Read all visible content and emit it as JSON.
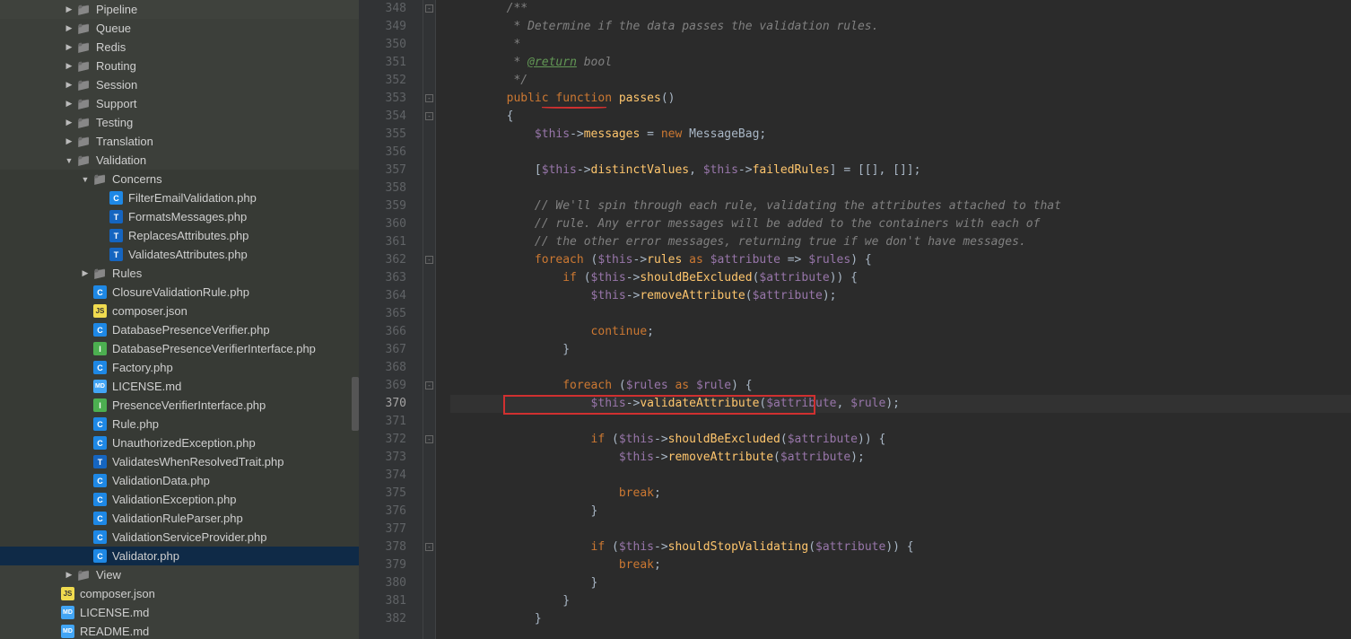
{
  "sidebar": {
    "items": [
      {
        "depth": 4,
        "arrow": "right",
        "icon": "folder",
        "label": "Pipeline",
        "shade": false
      },
      {
        "depth": 4,
        "arrow": "right",
        "icon": "folder",
        "label": "Queue",
        "shade": false
      },
      {
        "depth": 4,
        "arrow": "right",
        "icon": "folder",
        "label": "Redis",
        "shade": false
      },
      {
        "depth": 4,
        "arrow": "right",
        "icon": "folder",
        "label": "Routing",
        "shade": false
      },
      {
        "depth": 4,
        "arrow": "right",
        "icon": "folder",
        "label": "Session",
        "shade": false
      },
      {
        "depth": 4,
        "arrow": "right",
        "icon": "folder",
        "label": "Support",
        "shade": false
      },
      {
        "depth": 4,
        "arrow": "right",
        "icon": "folder",
        "label": "Testing",
        "shade": false
      },
      {
        "depth": 4,
        "arrow": "right",
        "icon": "folder",
        "label": "Translation",
        "shade": false
      },
      {
        "depth": 4,
        "arrow": "down",
        "icon": "folder",
        "label": "Validation",
        "shade": false
      },
      {
        "depth": 5,
        "arrow": "down",
        "icon": "folder",
        "label": "Concerns",
        "shade": true
      },
      {
        "depth": 6,
        "arrow": "",
        "icon": "c-blue",
        "iconText": "C",
        "label": "FilterEmailValidation.php",
        "shade": true
      },
      {
        "depth": 6,
        "arrow": "",
        "icon": "t-blue",
        "iconText": "T",
        "label": "FormatsMessages.php",
        "shade": true
      },
      {
        "depth": 6,
        "arrow": "",
        "icon": "t-blue",
        "iconText": "T",
        "label": "ReplacesAttributes.php",
        "shade": true
      },
      {
        "depth": 6,
        "arrow": "",
        "icon": "t-blue",
        "iconText": "T",
        "label": "ValidatesAttributes.php",
        "shade": true
      },
      {
        "depth": 5,
        "arrow": "right",
        "icon": "folder",
        "label": "Rules",
        "shade": true
      },
      {
        "depth": 5,
        "arrow": "",
        "icon": "c-blue",
        "iconText": "C",
        "label": "ClosureValidationRule.php",
        "shade": true
      },
      {
        "depth": 5,
        "arrow": "",
        "icon": "js-yellow",
        "iconText": "JS",
        "label": "composer.json",
        "shade": true
      },
      {
        "depth": 5,
        "arrow": "",
        "icon": "c-blue",
        "iconText": "C",
        "label": "DatabasePresenceVerifier.php",
        "shade": true
      },
      {
        "depth": 5,
        "arrow": "",
        "icon": "i-green",
        "iconText": "I",
        "label": "DatabasePresenceVerifierInterface.php",
        "shade": true
      },
      {
        "depth": 5,
        "arrow": "",
        "icon": "c-blue",
        "iconText": "C",
        "label": "Factory.php",
        "shade": true
      },
      {
        "depth": 5,
        "arrow": "",
        "icon": "md",
        "iconText": "MD",
        "label": "LICENSE.md",
        "shade": true
      },
      {
        "depth": 5,
        "arrow": "",
        "icon": "i-green",
        "iconText": "I",
        "label": "PresenceVerifierInterface.php",
        "shade": true
      },
      {
        "depth": 5,
        "arrow": "",
        "icon": "c-blue",
        "iconText": "C",
        "label": "Rule.php",
        "shade": true
      },
      {
        "depth": 5,
        "arrow": "",
        "icon": "c-blue",
        "iconText": "C",
        "label": "UnauthorizedException.php",
        "shade": true
      },
      {
        "depth": 5,
        "arrow": "",
        "icon": "t-blue",
        "iconText": "T",
        "label": "ValidatesWhenResolvedTrait.php",
        "shade": true
      },
      {
        "depth": 5,
        "arrow": "",
        "icon": "c-blue",
        "iconText": "C",
        "label": "ValidationData.php",
        "shade": true
      },
      {
        "depth": 5,
        "arrow": "",
        "icon": "c-blue",
        "iconText": "C",
        "label": "ValidationException.php",
        "shade": true
      },
      {
        "depth": 5,
        "arrow": "",
        "icon": "c-blue",
        "iconText": "C",
        "label": "ValidationRuleParser.php",
        "shade": true
      },
      {
        "depth": 5,
        "arrow": "",
        "icon": "c-blue",
        "iconText": "C",
        "label": "ValidationServiceProvider.php",
        "shade": true
      },
      {
        "depth": 5,
        "arrow": "",
        "icon": "c-blue",
        "iconText": "C",
        "label": "Validator.php",
        "shade": true,
        "selected": true
      },
      {
        "depth": 4,
        "arrow": "right",
        "icon": "folder",
        "label": "View",
        "shade": false
      },
      {
        "depth": 3,
        "arrow": "",
        "icon": "js-yellow",
        "iconText": "JS",
        "label": "composer.json",
        "shade": false
      },
      {
        "depth": 3,
        "arrow": "",
        "icon": "md",
        "iconText": "MD",
        "label": "LICENSE.md",
        "shade": false
      },
      {
        "depth": 3,
        "arrow": "",
        "icon": "md",
        "iconText": "MD",
        "label": "README.md",
        "shade": false
      }
    ]
  },
  "editor": {
    "first_line": 348,
    "current_line": 370,
    "lines": [
      {
        "n": 348,
        "raw": "     /**",
        "tokens": [
          [
            "k-comment",
            "/**"
          ]
        ],
        "indent": 2
      },
      {
        "n": 349,
        "raw": "      * Determine if the data passes the validation rules.",
        "tokens": [
          [
            "k-comment",
            " * Determine if the data passes the validation rules."
          ]
        ],
        "indent": 2
      },
      {
        "n": 350,
        "raw": "      *",
        "tokens": [
          [
            "k-comment",
            " *"
          ]
        ],
        "indent": 2
      },
      {
        "n": 351,
        "raw": "      * @return bool",
        "tokens": [
          [
            "k-comment",
            " * "
          ],
          [
            "k-doctag",
            "@return"
          ],
          [
            "k-comment",
            " bool"
          ]
        ],
        "indent": 2
      },
      {
        "n": 352,
        "raw": "      */",
        "tokens": [
          [
            "k-comment",
            " */"
          ]
        ],
        "indent": 2
      },
      {
        "n": 353,
        "raw": "     public function passes()",
        "tokens": [
          [
            "k-orange",
            "public function "
          ],
          [
            "k-func",
            "passes"
          ],
          [
            "k-op",
            "()"
          ]
        ],
        "indent": 2
      },
      {
        "n": 354,
        "raw": "     {",
        "tokens": [
          [
            "k-op",
            "{"
          ]
        ],
        "indent": 2
      },
      {
        "n": 355,
        "raw": "         $this->messages = new MessageBag;",
        "tokens": [
          [
            "k-var",
            "$this"
          ],
          [
            "k-op",
            "->"
          ],
          [
            "k-func",
            "messages"
          ],
          [
            "k-op",
            " = "
          ],
          [
            "k-orange",
            "new "
          ],
          [
            "k-type",
            "MessageBag"
          ],
          [
            "k-op",
            ";"
          ]
        ],
        "indent": 3
      },
      {
        "n": 356,
        "raw": "",
        "tokens": [],
        "indent": 0
      },
      {
        "n": 357,
        "raw": "         [$this->distinctValues, $this->failedRules] = [[], []];",
        "tokens": [
          [
            "k-op",
            "["
          ],
          [
            "k-var",
            "$this"
          ],
          [
            "k-op",
            "->"
          ],
          [
            "k-func",
            "distinctValues"
          ],
          [
            "k-op",
            ", "
          ],
          [
            "k-var",
            "$this"
          ],
          [
            "k-op",
            "->"
          ],
          [
            "k-func",
            "failedRules"
          ],
          [
            "k-op",
            "] = [[], []];"
          ]
        ],
        "indent": 3
      },
      {
        "n": 358,
        "raw": "",
        "tokens": [],
        "indent": 0
      },
      {
        "n": 359,
        "raw": "         // We'll spin through each rule, validating the attributes attached to that",
        "tokens": [
          [
            "k-comment",
            "// We'll spin through each rule, validating the attributes attached to that"
          ]
        ],
        "indent": 3
      },
      {
        "n": 360,
        "raw": "         // rule. Any error messages will be added to the containers with each of",
        "tokens": [
          [
            "k-comment",
            "// rule. Any error messages will be added to the containers with each of"
          ]
        ],
        "indent": 3
      },
      {
        "n": 361,
        "raw": "         // the other error messages, returning true if we don't have messages.",
        "tokens": [
          [
            "k-comment",
            "// the other error messages, returning true if we don't have messages."
          ]
        ],
        "indent": 3
      },
      {
        "n": 362,
        "raw": "         foreach ($this->rules as $attribute => $rules) {",
        "tokens": [
          [
            "k-orange",
            "foreach "
          ],
          [
            "k-op",
            "("
          ],
          [
            "k-var",
            "$this"
          ],
          [
            "k-op",
            "->"
          ],
          [
            "k-func",
            "rules"
          ],
          [
            "k-orange",
            " as "
          ],
          [
            "k-var",
            "$attribute"
          ],
          [
            "k-op",
            " => "
          ],
          [
            "k-var",
            "$rules"
          ],
          [
            "k-op",
            ") {"
          ]
        ],
        "indent": 3
      },
      {
        "n": 363,
        "raw": "             if ($this->shouldBeExcluded($attribute)) {",
        "tokens": [
          [
            "k-orange",
            "if "
          ],
          [
            "k-op",
            "("
          ],
          [
            "k-var",
            "$this"
          ],
          [
            "k-op",
            "->"
          ],
          [
            "k-func",
            "shouldBeExcluded"
          ],
          [
            "k-op",
            "("
          ],
          [
            "k-var",
            "$attribute"
          ],
          [
            "k-op",
            ")) {"
          ]
        ],
        "indent": 4
      },
      {
        "n": 364,
        "raw": "                 $this->removeAttribute($attribute);",
        "tokens": [
          [
            "k-var",
            "$this"
          ],
          [
            "k-op",
            "->"
          ],
          [
            "k-func",
            "removeAttribute"
          ],
          [
            "k-op",
            "("
          ],
          [
            "k-var",
            "$attribute"
          ],
          [
            "k-op",
            ");"
          ]
        ],
        "indent": 5
      },
      {
        "n": 365,
        "raw": "",
        "tokens": [],
        "indent": 0
      },
      {
        "n": 366,
        "raw": "                 continue;",
        "tokens": [
          [
            "k-orange",
            "continue"
          ],
          [
            "k-op",
            ";"
          ]
        ],
        "indent": 5
      },
      {
        "n": 367,
        "raw": "             }",
        "tokens": [
          [
            "k-op",
            "}"
          ]
        ],
        "indent": 4
      },
      {
        "n": 368,
        "raw": "",
        "tokens": [],
        "indent": 0
      },
      {
        "n": 369,
        "raw": "             foreach ($rules as $rule) {",
        "tokens": [
          [
            "k-orange",
            "foreach "
          ],
          [
            "k-op",
            "("
          ],
          [
            "k-var",
            "$rules"
          ],
          [
            "k-orange",
            " as "
          ],
          [
            "k-var",
            "$rule"
          ],
          [
            "k-op",
            ") {"
          ]
        ],
        "indent": 4
      },
      {
        "n": 370,
        "raw": "                 $this->validateAttribute($attribute, $rule);",
        "tokens": [
          [
            "k-var",
            "$this"
          ],
          [
            "k-op",
            "->"
          ],
          [
            "k-func",
            "validateAttribute"
          ],
          [
            "k-op",
            "("
          ],
          [
            "k-var",
            "$attribute"
          ],
          [
            "k-op",
            ", "
          ],
          [
            "k-var",
            "$rule"
          ],
          [
            "k-op",
            ");"
          ]
        ],
        "indent": 5
      },
      {
        "n": 371,
        "raw": "",
        "tokens": [],
        "indent": 0
      },
      {
        "n": 372,
        "raw": "                 if ($this->shouldBeExcluded($attribute)) {",
        "tokens": [
          [
            "k-orange",
            "if "
          ],
          [
            "k-op",
            "("
          ],
          [
            "k-var",
            "$this"
          ],
          [
            "k-op",
            "->"
          ],
          [
            "k-func",
            "shouldBeExcluded"
          ],
          [
            "k-op",
            "("
          ],
          [
            "k-var",
            "$attribute"
          ],
          [
            "k-op",
            ")) {"
          ]
        ],
        "indent": 5
      },
      {
        "n": 373,
        "raw": "                     $this->removeAttribute($attribute);",
        "tokens": [
          [
            "k-var",
            "$this"
          ],
          [
            "k-op",
            "->"
          ],
          [
            "k-func",
            "removeAttribute"
          ],
          [
            "k-op",
            "("
          ],
          [
            "k-var",
            "$attribute"
          ],
          [
            "k-op",
            ");"
          ]
        ],
        "indent": 6
      },
      {
        "n": 374,
        "raw": "",
        "tokens": [],
        "indent": 0
      },
      {
        "n": 375,
        "raw": "                     break;",
        "tokens": [
          [
            "k-orange",
            "break"
          ],
          [
            "k-op",
            ";"
          ]
        ],
        "indent": 6
      },
      {
        "n": 376,
        "raw": "                 }",
        "tokens": [
          [
            "k-op",
            "}"
          ]
        ],
        "indent": 5
      },
      {
        "n": 377,
        "raw": "",
        "tokens": [],
        "indent": 0
      },
      {
        "n": 378,
        "raw": "                 if ($this->shouldStopValidating($attribute)) {",
        "tokens": [
          [
            "k-orange",
            "if "
          ],
          [
            "k-op",
            "("
          ],
          [
            "k-var",
            "$this"
          ],
          [
            "k-op",
            "->"
          ],
          [
            "k-func",
            "shouldStopValidating"
          ],
          [
            "k-op",
            "("
          ],
          [
            "k-var",
            "$attribute"
          ],
          [
            "k-op",
            ")) {"
          ]
        ],
        "indent": 5
      },
      {
        "n": 379,
        "raw": "                     break;",
        "tokens": [
          [
            "k-orange",
            "break"
          ],
          [
            "k-op",
            ";"
          ]
        ],
        "indent": 6
      },
      {
        "n": 380,
        "raw": "                 }",
        "tokens": [
          [
            "k-op",
            "}"
          ]
        ],
        "indent": 5
      },
      {
        "n": 381,
        "raw": "             }",
        "tokens": [
          [
            "k-op",
            "}"
          ]
        ],
        "indent": 4
      },
      {
        "n": 382,
        "raw": "         }",
        "tokens": [
          [
            "k-op",
            "}"
          ]
        ],
        "indent": 3
      }
    ]
  }
}
